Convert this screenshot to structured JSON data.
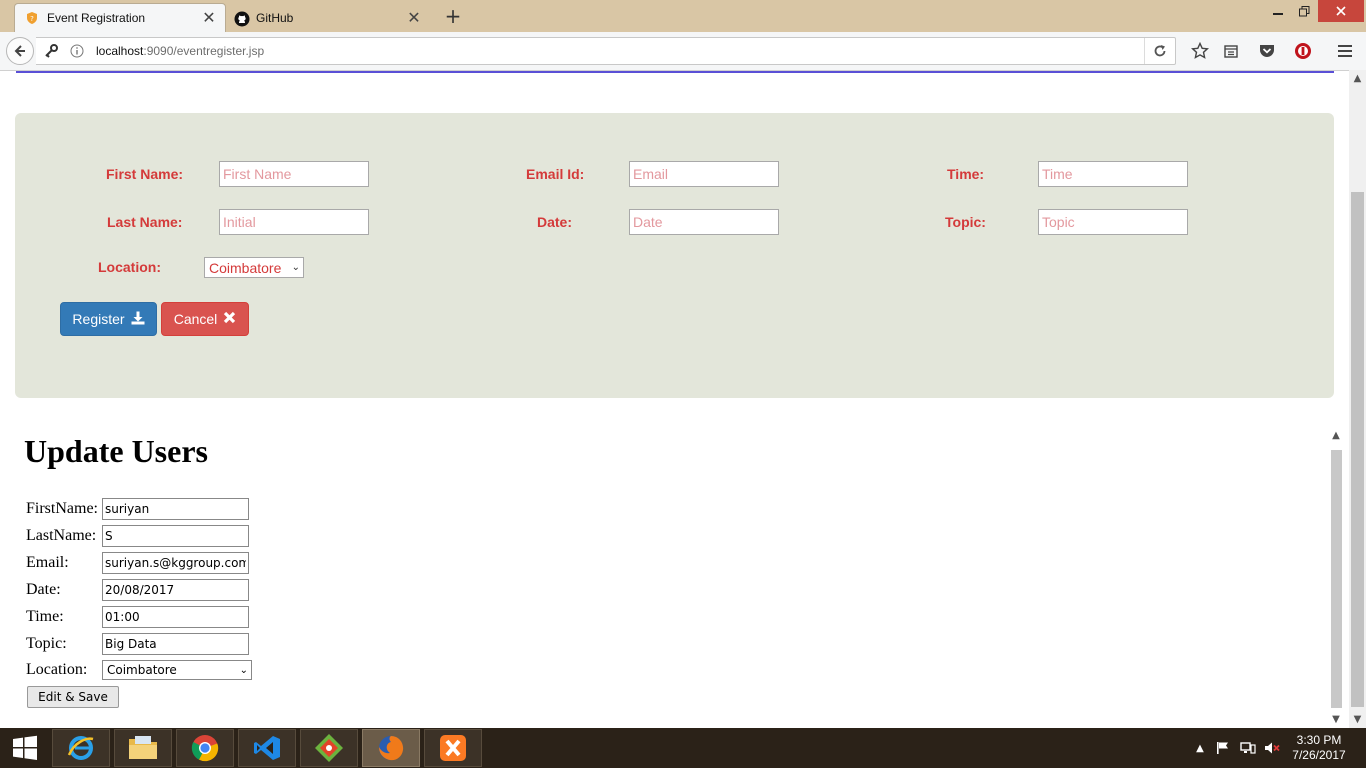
{
  "browser": {
    "tabs": [
      {
        "label": "Event Registration",
        "active": true,
        "icon": "shield-favicon"
      },
      {
        "label": "GitHub",
        "active": false,
        "icon": "github-favicon"
      }
    ],
    "url_host": "localhost",
    "url_rest": ":9090/eventregister.jsp"
  },
  "registration": {
    "first_name_label": "First Name:",
    "first_name_placeholder": "First Name",
    "last_name_label": "Last Name:",
    "last_name_placeholder": "Initial",
    "email_label": "Email Id:",
    "email_placeholder": "Email",
    "date_label": "Date:",
    "date_placeholder": "Date",
    "time_label": "Time:",
    "time_placeholder": "Time",
    "topic_label": "Topic:",
    "topic_placeholder": "Topic",
    "location_label": "Location:",
    "location_value": "Coimbatore",
    "register_label": "Register",
    "cancel_label": "Cancel"
  },
  "update": {
    "heading": "Update Users",
    "fields": [
      {
        "label": "FirstName:",
        "value": "suriyan"
      },
      {
        "label": "LastName:",
        "value": "S"
      },
      {
        "label": "Email:",
        "value": "suriyan.s@kggroup.com"
      },
      {
        "label": "Date:",
        "value": "20/08/2017"
      },
      {
        "label": "Time:",
        "value": "01:00"
      },
      {
        "label": "Topic:",
        "value": "Big Data"
      }
    ],
    "location_label": "Location:",
    "location_value": "Coimbatore",
    "save_label": "Edit & Save"
  },
  "taskbar": {
    "apps": [
      "internet-explorer",
      "file-explorer",
      "chrome",
      "visual-studio",
      "git",
      "firefox",
      "xampp"
    ],
    "active_app": "firefox",
    "time": "3:30 PM",
    "date": "7/26/2017"
  },
  "colors": {
    "panel_bg": "#e3e6da",
    "label_red": "#d43a3a",
    "register_blue": "#337ab7",
    "cancel_red": "#d9534f",
    "accent_line": "#5a4fd6"
  }
}
